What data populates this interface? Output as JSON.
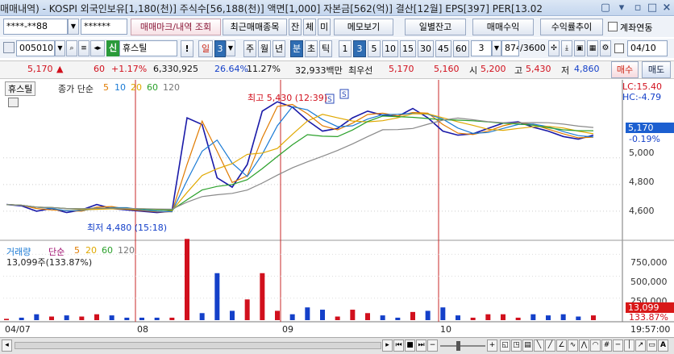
{
  "titlebar": {
    "text": "매매내역) - KOSPI 외국인보유[1,180(천)] 주식수[56,188(천)] 액면[1,000] 자본금[562(억)] 결산[12월] EPS[397] PER[13.02"
  },
  "toolbar1": {
    "account_value": "****-**88",
    "password_value": "******",
    "btn_trade_mark": "매매마크/내역 조회",
    "btn_recent": "최근매매종목",
    "btn_balance": "잔",
    "btn_fill": "체",
    "btn_unfilled": "미",
    "btn_memo": "메모보기",
    "btn_daily_balance": "일별잔고",
    "btn_trade_profit": "매매수익",
    "btn_profit_trend": "수익률추이",
    "account_link_label": "계좌연동"
  },
  "toolbar2": {
    "stock_code": "005010",
    "new_badge": "신",
    "stock_name": "휴스틸",
    "warn_label": "!",
    "period_day": "일",
    "period_count": "3",
    "period_week": "주",
    "period_month": "월",
    "period_year": "년",
    "period_minute": "분",
    "period_second": "초",
    "period_tick": "틱",
    "intervals": [
      "1",
      "3",
      "5",
      "10",
      "15",
      "30",
      "45",
      "60"
    ],
    "interval_selected": "3",
    "interval_dropdown": "3",
    "bars_shown": "874",
    "bars_total": "/3600",
    "date_value": "04/10"
  },
  "quote": {
    "price": "5,170",
    "arrow": "▲",
    "change": "60",
    "change_pct": "+1.17%",
    "volume": "6,330,925",
    "turnover_pct": "26.64%",
    "pct2": "11.27%",
    "amount": "32,933백만",
    "best_label": "최우선",
    "best_ask": "5,170",
    "best_bid": "5,160",
    "open_label": "시",
    "open": "5,200",
    "high_label": "고",
    "high": "5,430",
    "low_label": "저",
    "low": "4,860",
    "buy_label": "매수",
    "sell_label": "매도"
  },
  "colors": {
    "price_line": "#1a1aa8",
    "ma5": "#e07b00",
    "ma10": "#1a7ad4",
    "ma20": "#e0a800",
    "ma60": "#2aa02a",
    "ma120": "#8a8a8a",
    "up": "#d1101d",
    "down": "#1440c9",
    "day_divider": "#c82828"
  },
  "price_panel": {
    "stock_label": "휴스틸",
    "ma_title": "종가 단순",
    "ma_periods": [
      "5",
      "10",
      "20",
      "60",
      "120"
    ],
    "high_annotation": "최고 5,430 (12:39)",
    "low_annotation": "최저 4,480 (15:18)",
    "lc": "LC:15.40",
    "hc": "HC:-4.79",
    "current_price_tag": "5,170",
    "current_pct": "-0.19%",
    "y_ticks": [
      "5,000",
      "4,800",
      "4,600"
    ]
  },
  "volume_panel": {
    "title": "거래량",
    "ma_title": "단순",
    "ma_periods": [
      "5",
      "20",
      "60",
      "120"
    ],
    "current": "13,099주(133.87%)",
    "y_ticks": [
      "750,000",
      "500,000",
      "250,000"
    ],
    "current_tag": "13,099",
    "current_pct_tag": "133.87%"
  },
  "x_axis": {
    "labels": [
      "04/07",
      "08",
      "09",
      "10"
    ],
    "time": "19:57:00"
  },
  "chart_data": {
    "type": "line",
    "title": "",
    "x": [
      "04/07",
      "08",
      "09",
      "10"
    ],
    "series": [
      {
        "name": "종가",
        "values": [
          4650,
          4640,
          4600,
          4620,
          4590,
          4610,
          4650,
          4620,
          4610,
          4600,
          4590,
          4600,
          5300,
          5250,
          4850,
          4780,
          4950,
          5350,
          5420,
          5380,
          5280,
          5200,
          5220,
          5300,
          5350,
          5320,
          5310,
          5370,
          5300,
          5200,
          5170,
          5180,
          5220,
          5260,
          5270,
          5230,
          5200,
          5160,
          5140,
          5170
        ]
      }
    ],
    "ylim": [
      4400,
      5500
    ]
  },
  "bottombar": {
    "minus": "−",
    "plus": "+",
    "a_label": "A"
  }
}
